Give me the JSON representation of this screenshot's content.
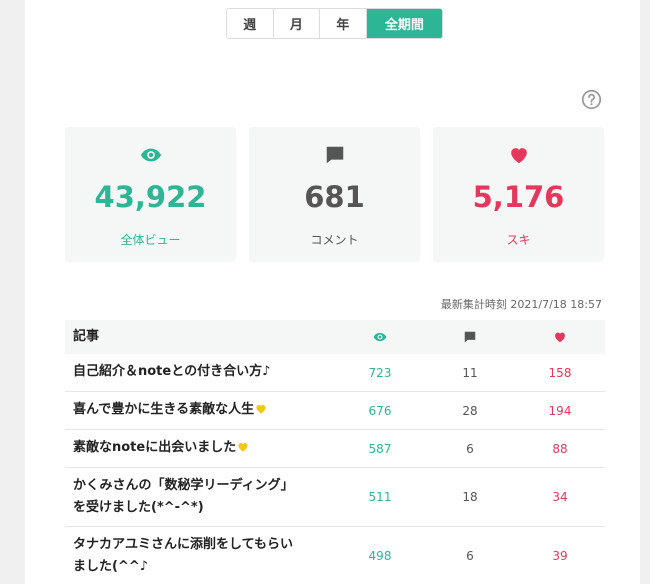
{
  "period_tabs": [
    {
      "label": "週"
    },
    {
      "label": "月"
    },
    {
      "label": "年"
    },
    {
      "label": "全期間",
      "active": true
    }
  ],
  "stats": {
    "views": {
      "value": "43,922",
      "label": "全体ビュー"
    },
    "comments": {
      "value": "681",
      "label": "コメント"
    },
    "likes": {
      "value": "5,176",
      "label": "スキ"
    }
  },
  "updated_text": "最新集計時刻 2021/7/18 18:57",
  "table": {
    "header_title": "記事",
    "rows": [
      {
        "title": "自己紹介＆noteとの付き合い方♪",
        "views": "723",
        "comments": "11",
        "likes": "158"
      },
      {
        "title": "喜んで豊かに生きる素敵な人生",
        "views": "676",
        "comments": "28",
        "likes": "194"
      },
      {
        "title": "素敵なnoteに出会いました",
        "views": "587",
        "comments": "6",
        "likes": "88"
      },
      {
        "title_line1": "かくみさんの「数秘学リーディング」",
        "title_line2": "を受けました(*^-^*)",
        "views": "511",
        "comments": "18",
        "likes": "34"
      },
      {
        "title_line1": "タナカアユミさんに添削をしてもらい",
        "title_line2": "ました(^^♪",
        "views": "498",
        "comments": "6",
        "likes": "39"
      }
    ]
  },
  "colors": {
    "accent": "#2cb696",
    "like": "#e5375b",
    "comment": "#555555"
  }
}
